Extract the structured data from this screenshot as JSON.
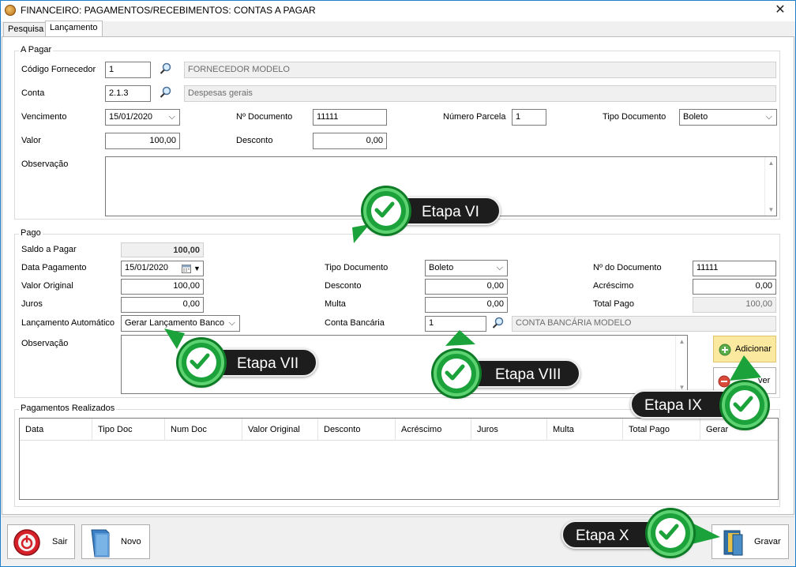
{
  "window": {
    "title": "FINANCEIRO: PAGAMENTOS/RECEBIMENTOS: CONTAS A PAGAR",
    "close_glyph": "✕"
  },
  "tabs": [
    {
      "label": "Pesquisa",
      "active": false
    },
    {
      "label": "Lançamento",
      "active": true
    }
  ],
  "a_pagar": {
    "title": "A Pagar",
    "codigo_fornecedor": {
      "label": "Código Fornecedor",
      "value": "1",
      "description": "FORNECEDOR MODELO"
    },
    "conta": {
      "label": "Conta",
      "value": "2.1.3",
      "description": "Despesas gerais"
    },
    "vencimento": {
      "label": "Vencimento",
      "value": "15/01/2020"
    },
    "n_documento": {
      "label": "Nº Documento",
      "value": "11111"
    },
    "numero_parcela": {
      "label": "Número Parcela",
      "value": "1"
    },
    "tipo_documento": {
      "label": "Tipo Documento",
      "value": "Boleto"
    },
    "valor": {
      "label": "Valor",
      "value": "100,00"
    },
    "desconto": {
      "label": "Desconto",
      "value": "0,00"
    },
    "observacao": {
      "label": "Observação",
      "value": ""
    }
  },
  "pago": {
    "title": "Pago",
    "saldo_a_pagar": {
      "label": "Saldo a Pagar",
      "value": "100,00"
    },
    "data_pagamento": {
      "label": "Data Pagamento",
      "value": "15/01/2020"
    },
    "valor_original": {
      "label": "Valor Original",
      "value": "100,00"
    },
    "juros": {
      "label": "Juros",
      "value": "0,00"
    },
    "lancamento_automatico": {
      "label": "Lançamento Automático",
      "value": "Gerar Lançamento Banco"
    },
    "observacao": {
      "label": "Observação",
      "value": ""
    },
    "tipo_documento": {
      "label": "Tipo Documento",
      "value": "Boleto"
    },
    "desconto": {
      "label": "Desconto",
      "value": "0,00"
    },
    "multa": {
      "label": "Multa",
      "value": "0,00"
    },
    "conta_bancaria": {
      "label": "Conta Bancária",
      "value": "1",
      "description": "CONTA BANCÁRIA MODELO"
    },
    "n_do_documento": {
      "label": "Nº do Documento",
      "value": "11111"
    },
    "acrescimo": {
      "label": "Acréscimo",
      "value": "0,00"
    },
    "total_pago": {
      "label": "Total Pago",
      "value": "100,00"
    },
    "adicionar_label": "Adicionar",
    "remover_label_partial": "ver"
  },
  "pagamentos_realizados": {
    "title": "Pagamentos Realizados",
    "columns": [
      "Data",
      "Tipo Doc",
      "Num Doc",
      "Valor Original",
      "Desconto",
      "Acréscimo",
      "Juros",
      "Multa",
      "Total Pago",
      "Gerar"
    ]
  },
  "footer": {
    "sair_label": "Sair",
    "novo_label": "Novo",
    "gravar_label": "Gravar"
  },
  "callouts": [
    "Etapa VI",
    "Etapa VII",
    "Etapa VIII",
    "Etapa IX",
    "Etapa X"
  ],
  "colors": {
    "callout_green": "#1ca23a",
    "callout_bg": "#1d1d1d",
    "window_border": "#1e80c8",
    "adicionar_bg": "#fbe9a0"
  }
}
